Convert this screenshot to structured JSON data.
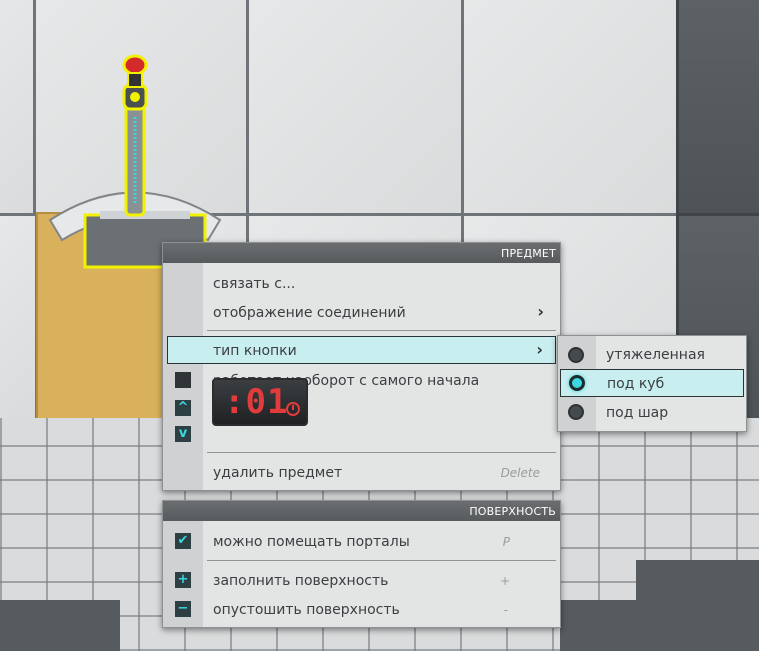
{
  "item_menu": {
    "header": "ПРЕДМЕТ",
    "connect": "связать с...",
    "connection_display": "отображение соединений",
    "button_type": "тип кнопки",
    "reverse": "работает наоборот с самого начала",
    "timer_value": ":01",
    "delete": "удалить предмет",
    "delete_hint": "Delete",
    "reverse_checked": false,
    "timer_up_glyph": "^",
    "timer_down_glyph": "v"
  },
  "button_type_submenu": {
    "options": [
      "утяжеленная",
      "под куб",
      "под шар"
    ],
    "selected": "под куб"
  },
  "surface_menu": {
    "header": "ПОВЕРХНОСТЬ",
    "portals": "можно помещать порталы",
    "portals_hint": "P",
    "portals_checked": true,
    "fill": "заполнить поверхность",
    "fill_hint": "+",
    "empty": "опустошить поверхность",
    "empty_hint": "-",
    "check_glyph": "✔",
    "plus_glyph": "+",
    "minus_glyph": "−"
  },
  "colors": {
    "accent": "#39d7e0",
    "highlight": "#c9eef0",
    "selection_glow": "#f2f200",
    "timer_red": "#e23b3b",
    "button_red": "#d42a2a"
  },
  "icons": {
    "submenu_arrow": "›"
  }
}
